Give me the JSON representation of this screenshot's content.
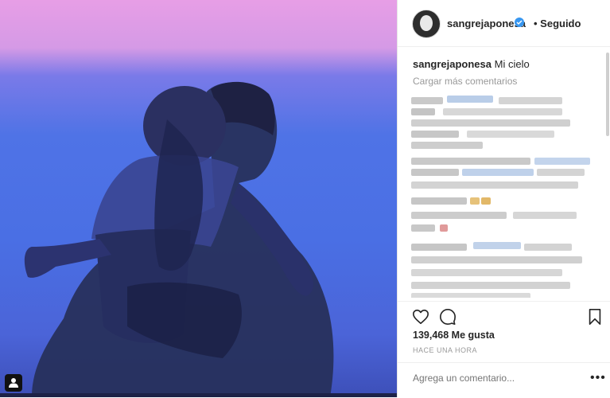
{
  "post": {
    "username": "sangrejaponesa",
    "follow_status": "• Seguido",
    "caption_user": "sangrejaponesa",
    "caption_text": "Mi cielo",
    "load_more": "Cargar más comentarios",
    "likes": "139,468 Me gusta",
    "time": "HACE UNA HORA",
    "comment_placeholder": "Agrega un comentario...",
    "options": "•••"
  },
  "icons": {
    "verified": "verified-badge-icon",
    "like": "heart-icon",
    "comment": "comment-bubble-icon",
    "save": "bookmark-icon",
    "tag": "user-tag-icon"
  },
  "colors": {
    "verified": "#3897f0",
    "sky_top": "#e79ee6",
    "sky_bottom": "#3d4fb8"
  }
}
